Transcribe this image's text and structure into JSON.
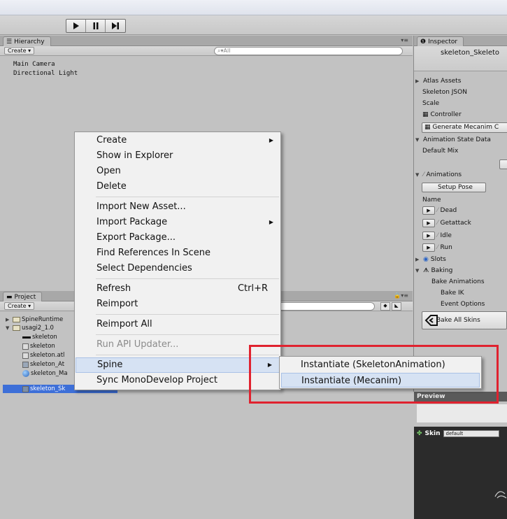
{
  "hierarchy": {
    "tab_label": "Hierarchy",
    "create_label": "Create",
    "search_placeholder": "All",
    "items": [
      "Main Camera",
      "Directional Light"
    ]
  },
  "project": {
    "tab_label": "Project",
    "create_label": "Create",
    "tree": [
      {
        "label": "SpineRuntime"
      },
      {
        "label": "usagi2_1.0"
      },
      {
        "label": "skeleton"
      },
      {
        "label": "skeleton"
      },
      {
        "label": "skeleton.atl"
      },
      {
        "label": "skeleton_At"
      },
      {
        "label": "skeleton_Ma"
      },
      {
        "label": "skeleton_Sk"
      }
    ]
  },
  "inspector": {
    "tab_label": "Inspector",
    "title": "skeleton_Skeleto",
    "atlas_assets": "Atlas Assets",
    "skeleton_json": "Skeleton JSON",
    "scale": "Scale",
    "controller": "Controller",
    "generate_btn": "Generate Mecanim C",
    "anim_state_data": "Animation State Data",
    "default_mix": "Default Mix",
    "animations": "Animations",
    "setup_pose": "Setup Pose",
    "name": "Name",
    "anim_list": [
      "Dead",
      "Getattack",
      "Idle",
      "Run"
    ],
    "slots": "Slots",
    "baking": "Baking",
    "bake_animations": "Bake Animations",
    "bake_ik": "Bake IK",
    "event_options": "Event Options",
    "bake_all_skins": "Bake All Skins"
  },
  "preview": {
    "label": "Preview",
    "skin_label": "Skin",
    "skin_value": "default"
  },
  "context_menu": {
    "items": [
      {
        "label": "Create",
        "submenu": true
      },
      {
        "label": "Show in Explorer"
      },
      {
        "label": "Open"
      },
      {
        "label": "Delete"
      },
      {
        "label": "Import New Asset..."
      },
      {
        "label": "Import Package",
        "submenu": true
      },
      {
        "label": "Export Package..."
      },
      {
        "label": "Find References In Scene"
      },
      {
        "label": "Select Dependencies"
      },
      {
        "label": "Refresh",
        "shortcut": "Ctrl+R"
      },
      {
        "label": "Reimport"
      },
      {
        "label": "Reimport All"
      },
      {
        "label": "Run API Updater...",
        "disabled": true
      },
      {
        "label": "Spine",
        "submenu": true
      },
      {
        "label": "Sync MonoDevelop Project"
      }
    ],
    "spine_submenu": [
      "Instantiate (SkeletonAnimation)",
      "Instantiate (Mecanim)"
    ]
  },
  "colors": {
    "highlight_box": "#e0222f",
    "selection": "#3d6fd8",
    "menu_hover": "#d6e2f3"
  }
}
